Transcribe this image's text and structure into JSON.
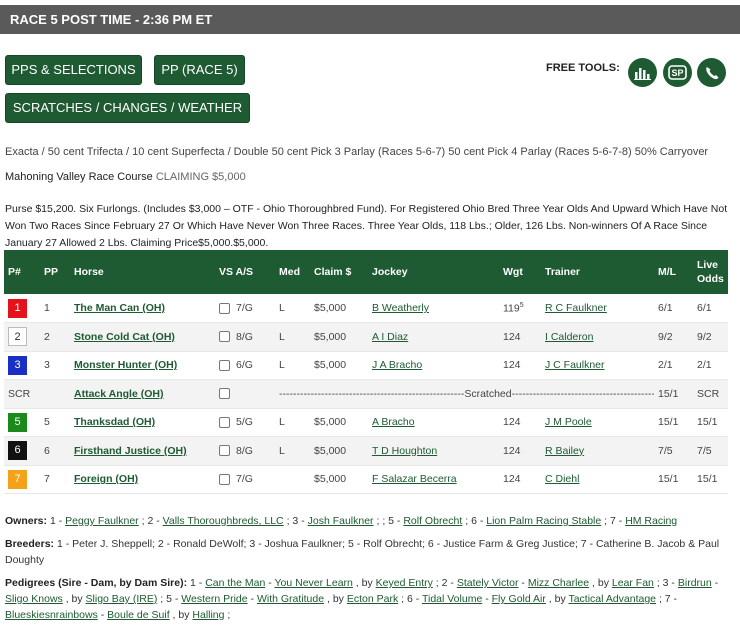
{
  "header": {
    "title": "RACE 5 POST TIME - 2:36 PM ET"
  },
  "buttons": {
    "pps": "PPS & SELECTIONS",
    "pp": "PP (RACE 5)",
    "scratches": "SCRATCHES / CHANGES / WEATHER"
  },
  "tools": {
    "label": "FREE TOOLS:"
  },
  "race_info": {
    "wagers": "Exacta / 50 cent Trifecta / 10 cent Superfecta / Double 50 cent Pick 3 Parlay (Races 5-6-7) 50 cent Pick 4 Parlay (Races 5-6-7-8) 50% Carryover",
    "track": "Mahoning Valley Race Course",
    "class": "CLAIMING $5,000",
    "purse": "Purse $15,200. Six Furlongs. (Includes $3,000 – OTF - Ohio Thoroughbred Fund). For Registered Ohio Bred Three Year Olds And Upward Which Have Not Won Two Races Since February 27 Or Which Have Never Won Three Races. Three Year Olds, 118 Lbs.; Older, 126 Lbs. Non-winners Of A Race Since January 27 Allowed 2 Lbs. Claiming Price$5,000.$5,000."
  },
  "table": {
    "headers": {
      "pn": "P#",
      "pp": "PP",
      "horse": "Horse",
      "vs": "VS A/S",
      "med": "Med",
      "claim": "Claim $",
      "jockey": "Jockey",
      "wgt": "Wgt",
      "trainer": "Trainer",
      "ml": "M/L",
      "live_a": "Live",
      "live_b": "Odds"
    },
    "rows": [
      {
        "pn": "1",
        "pp": "1",
        "horse": "The Man Can (OH)",
        "as": "7/G",
        "med": "L",
        "claim": "$5,000",
        "jockey": "B Weatherly",
        "wgt": "119",
        "wgt_sup": "5",
        "trainer": "R C Faulkner",
        "ml": "6/1",
        "live": "6/1"
      },
      {
        "pn": "2",
        "pp": "2",
        "horse": "Stone Cold Cat (OH)",
        "as": "8/G",
        "med": "L",
        "claim": "$5,000",
        "jockey": "A I Diaz",
        "wgt": "124",
        "wgt_sup": "",
        "trainer": "I Calderon",
        "ml": "9/2",
        "live": "9/2"
      },
      {
        "pn": "3",
        "pp": "3",
        "horse": "Monster Hunter (OH)",
        "as": "6/G",
        "med": "L",
        "claim": "$5,000",
        "jockey": "J A Bracho",
        "wgt": "124",
        "wgt_sup": "",
        "trainer": "J C Faulkner",
        "ml": "2/1",
        "live": "2/1"
      },
      {
        "pn": "SCR",
        "pp": "",
        "horse": "Attack Angle (OH)",
        "scratched": "-----------------------------------------------------Scratched-----------------------------------------------------",
        "ml": "15/1",
        "live": "SCR"
      },
      {
        "pn": "5",
        "pp": "5",
        "horse": "Thanksdad (OH)",
        "as": "5/G",
        "med": "L",
        "claim": "$5,000",
        "jockey": "A Bracho",
        "wgt": "124",
        "wgt_sup": "",
        "trainer": "J M Poole",
        "ml": "15/1",
        "live": "15/1"
      },
      {
        "pn": "6",
        "pp": "6",
        "horse": "Firsthand Justice (OH)",
        "as": "8/G",
        "med": "L",
        "claim": "$5,000",
        "jockey": "T D Houghton",
        "wgt": "124",
        "wgt_sup": "",
        "trainer": "R Bailey",
        "ml": "7/5",
        "live": "7/5"
      },
      {
        "pn": "7",
        "pp": "7",
        "horse": "Foreign (OH)",
        "as": "7/G",
        "med": "",
        "claim": "$5,000",
        "jockey": "F Salazar Becerra",
        "wgt": "124",
        "wgt_sup": "",
        "trainer": "C Diehl",
        "ml": "15/1",
        "live": "15/1"
      }
    ]
  },
  "pgm_colors": {
    "1": "#e4121b",
    "2": "#ffffff",
    "3": "#1a2fc6",
    "5": "#1b8a1b",
    "6": "#111111",
    "7": "#f5a21b"
  },
  "owners": {
    "label": "Owners:",
    "items": [
      {
        "n": "1",
        "name": "Peggy Faulkner"
      },
      {
        "n": "2",
        "name": "Valls Thoroughbreds, LLC"
      },
      {
        "n": "3",
        "name": "Josh Faulkner"
      },
      {
        "n": "5",
        "name": "Rolf Obrecht"
      },
      {
        "n": "6",
        "name": "Lion Palm Racing Stable"
      },
      {
        "n": "7",
        "name": "HM Racing"
      }
    ]
  },
  "breeders": {
    "label": "Breeders:",
    "text": "1 - Peter J. Sheppell; 2 - Ronald DeWolf; 3 - Joshua Faulkner; 5 - Rolf Obrecht; 6 - Justice Farm & Greg Justice; 7 - Catherine B. Jacob & Paul Doughty"
  },
  "pedigrees": {
    "label": "Pedigrees (Sire - Dam, by Dam Sire):",
    "items": [
      {
        "n": "1",
        "sire": "Can the Man",
        "dam": "You Never Learn",
        "damsire": "Keyed Entry"
      },
      {
        "n": "2",
        "sire": "Stately Victor",
        "dam": "Mizz Charlee",
        "damsire": "Lear Fan"
      },
      {
        "n": "3",
        "sire": "Birdrun",
        "dam": "Sligo Knows",
        "damsire": "Sligo Bay (IRE)"
      },
      {
        "n": "5",
        "sire": "Western Pride",
        "dam": "With Gratitude",
        "damsire": "Ecton Park"
      },
      {
        "n": "6",
        "sire": "Tidal Volume",
        "dam": "Fly Gold Air",
        "damsire": "Tactical Advantage"
      },
      {
        "n": "7",
        "sire": "Blueskiesnrainbows",
        "dam": "Boule de Suif",
        "damsire": "Halling"
      }
    ]
  }
}
